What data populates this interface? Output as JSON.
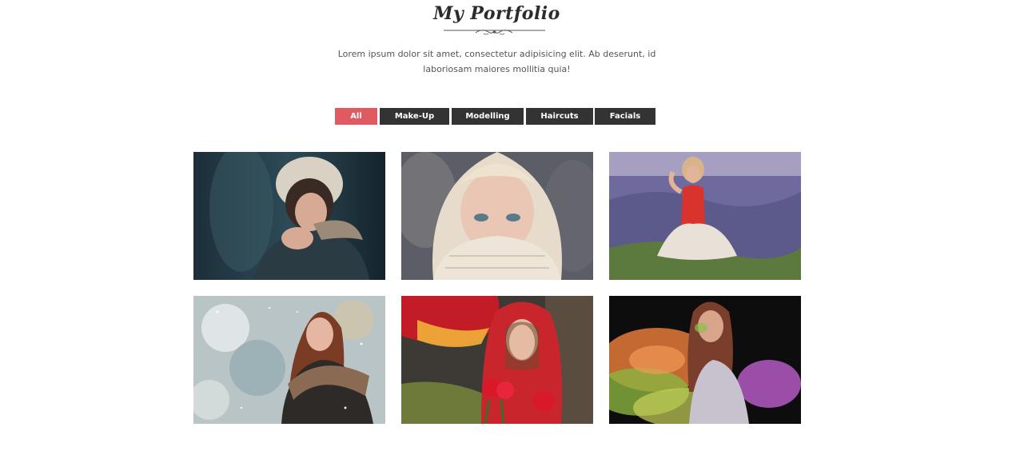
{
  "header": {
    "title": "My Portfolio",
    "description_line1": "Lorem ipsum dolor sit amet, consectetur adipisicing elit. Ab deserunt, id",
    "description_line2": "laboriosam maiores mollitia quia!"
  },
  "filters": [
    {
      "label": "All",
      "active": true
    },
    {
      "label": "Make-Up",
      "active": false
    },
    {
      "label": "Modelling",
      "active": false
    },
    {
      "label": "Haircuts",
      "active": false
    },
    {
      "label": "Facials",
      "active": false
    }
  ],
  "colors": {
    "accent": "#e05a62",
    "filter_bg": "#333333",
    "title": "#2b2b2b",
    "text": "#555555"
  },
  "gallery": [
    {
      "image": "woman-in-fur-hood-photo"
    },
    {
      "image": "blonde-woman-in-sweater-photo"
    },
    {
      "image": "woman-in-lavender-field-photo"
    },
    {
      "image": "woman-in-snow-photo"
    },
    {
      "image": "woman-in-red-headscarf-photo"
    },
    {
      "image": "woman-in-colored-powder-photo"
    }
  ]
}
